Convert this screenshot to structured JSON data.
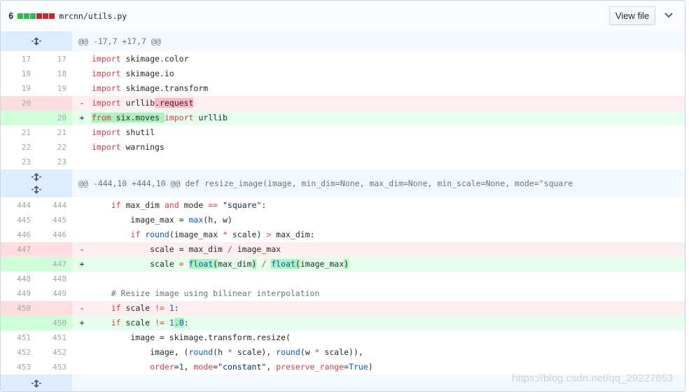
{
  "header": {
    "count": "6",
    "stat_colors": [
      "#2cbe4e",
      "#2cbe4e",
      "#2cbe4e",
      "#cb2431",
      "#cb2431",
      "#cb2431"
    ],
    "path": "mrcnn/utils.py",
    "view_file_label": "View file",
    "chevron_icon": "chevron-down-icon"
  },
  "hunks": [
    {
      "label": "@@ -17,7 +17,7 @@",
      "expand_icon": "unfold-icon"
    },
    {
      "label": "@@ -444,10 +444,10 @@ def resize_image(image, min_dim=None, max_dim=None, min_scale=None, mode=\"square",
      "expand_icon": "unfold-icon"
    }
  ],
  "lines": [
    {
      "type": "ctx",
      "old": "17",
      "new": "17",
      "sign": "",
      "code": "import skimage.color"
    },
    {
      "type": "ctx",
      "old": "18",
      "new": "18",
      "sign": "",
      "code": "import skimage.io"
    },
    {
      "type": "ctx",
      "old": "19",
      "new": "19",
      "sign": "",
      "code": "import skimage.transform"
    },
    {
      "type": "del",
      "old": "20",
      "new": "",
      "sign": "-",
      "code": "import urllib.request"
    },
    {
      "type": "add",
      "old": "",
      "new": "20",
      "sign": "+",
      "code": "from six.moves import urllib"
    },
    {
      "type": "ctx",
      "old": "21",
      "new": "21",
      "sign": "",
      "code": "import shutil"
    },
    {
      "type": "ctx",
      "old": "22",
      "new": "22",
      "sign": "",
      "code": "import warnings"
    },
    {
      "type": "ctx",
      "old": "23",
      "new": "23",
      "sign": "",
      "code": ""
    },
    {
      "type": "ctx",
      "old": "444",
      "new": "444",
      "sign": "",
      "code": "    if max_dim and mode == \"square\":"
    },
    {
      "type": "ctx",
      "old": "445",
      "new": "445",
      "sign": "",
      "code": "        image_max = max(h, w)"
    },
    {
      "type": "ctx",
      "old": "446",
      "new": "446",
      "sign": "",
      "code": "        if round(image_max * scale) > max_dim:"
    },
    {
      "type": "del",
      "old": "447",
      "new": "",
      "sign": "-",
      "code": "            scale = max_dim / image_max"
    },
    {
      "type": "add",
      "old": "",
      "new": "447",
      "sign": "+",
      "code": "            scale = float(max_dim) / float(image_max)"
    },
    {
      "type": "ctx",
      "old": "448",
      "new": "448",
      "sign": "",
      "code": ""
    },
    {
      "type": "ctx",
      "old": "449",
      "new": "449",
      "sign": "",
      "code": "    # Resize image using bilinear interpolation"
    },
    {
      "type": "del",
      "old": "450",
      "new": "",
      "sign": "-",
      "code": "    if scale != 1:"
    },
    {
      "type": "add",
      "old": "",
      "new": "450",
      "sign": "+",
      "code": "    if scale != 1.0:"
    },
    {
      "type": "ctx",
      "old": "451",
      "new": "451",
      "sign": "",
      "code": "        image = skimage.transform.resize("
    },
    {
      "type": "ctx",
      "old": "452",
      "new": "452",
      "sign": "",
      "code": "            image, (round(h * scale), round(w * scale)),"
    },
    {
      "type": "ctx",
      "old": "453",
      "new": "453",
      "sign": "",
      "code": "            order=1, mode=\"constant\", preserve_range=True)"
    }
  ],
  "watermark": "https://blog.csdn.net/qq_29227653"
}
